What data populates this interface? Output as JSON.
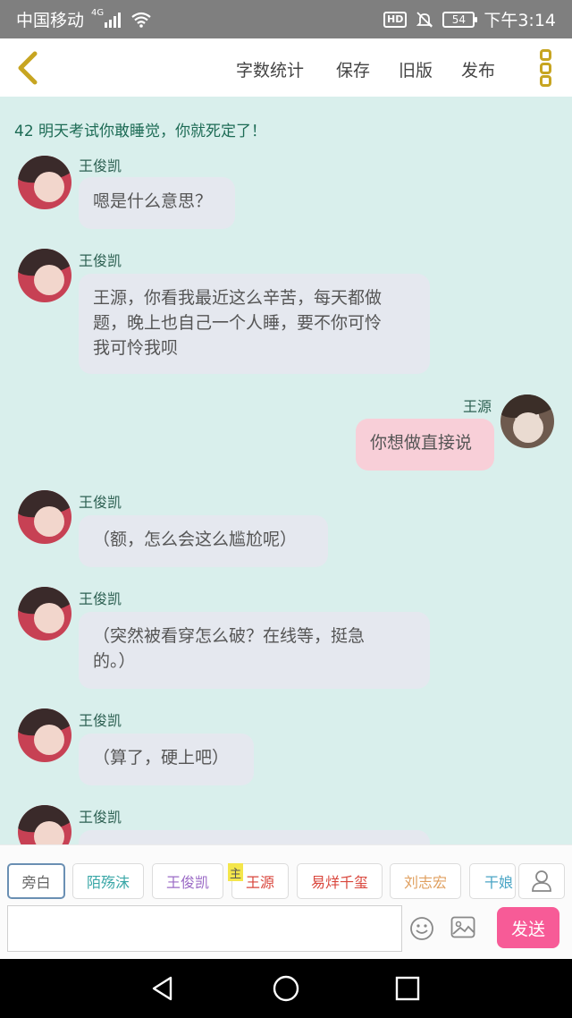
{
  "status_bar": {
    "carrier": "中国移动",
    "network": "4G",
    "hd": "HD",
    "battery": "54",
    "time": "下午3:14",
    "icons": [
      "signal-icon",
      "wifi-icon",
      "hd-icon",
      "mute-bell-icon",
      "battery-icon"
    ]
  },
  "toolbar": {
    "back_icon": "chevron-left-icon",
    "items": [
      "字数统计",
      "保存",
      "旧版",
      "发布"
    ],
    "more_icon": "more-vertical-icon",
    "accent": "#c7a521"
  },
  "chat": {
    "title": "42 明天考试你敢睡觉，你就死定了！",
    "messages": [
      {
        "side": "left",
        "name": "王俊凯",
        "text": "嗯是什么意思？"
      },
      {
        "side": "left",
        "name": "王俊凯",
        "lines": [
          "王源，你看我最近这么辛苦，每天都做",
          "题，晚上也自己一个人睡，要不你可怜",
          "我可怜我呗"
        ]
      },
      {
        "side": "right",
        "name": "王源",
        "text": "你想做直接说"
      },
      {
        "side": "left",
        "name": "王俊凯",
        "text": "（额，怎么会这么尴尬呢）"
      },
      {
        "side": "left",
        "name": "王俊凯",
        "lines": [
          "（突然被看穿怎么破？在线等，挺急",
          "的。）"
        ]
      },
      {
        "side": "left",
        "name": "王俊凯",
        "text": "（算了，硬上吧）"
      },
      {
        "side": "left",
        "name": "王俊凯",
        "text": ""
      }
    ]
  },
  "roles": {
    "items": [
      {
        "label": "旁白",
        "color": "#666666"
      },
      {
        "label": "陌殇沫",
        "color": "#3aa7a7"
      },
      {
        "label": "王俊凯",
        "color": "#9b6bc6"
      },
      {
        "label": "王源",
        "color": "#d9463c"
      },
      {
        "label": "易烊千玺",
        "color": "#d9463c"
      },
      {
        "label": "刘志宏",
        "color": "#e0a060"
      },
      {
        "label": "干娘",
        "color": "#4ba6c6"
      }
    ],
    "host_badge": "主",
    "user_icon": "user-icon"
  },
  "input": {
    "value": "",
    "placeholder": "",
    "emoji_icon": "emoji-icon",
    "image_icon": "image-icon",
    "send_label": "发送",
    "send_color": "#f75b97"
  },
  "nav_bar": {
    "icons": [
      "back-triangle-icon",
      "home-circle-icon",
      "recents-square-icon"
    ]
  }
}
